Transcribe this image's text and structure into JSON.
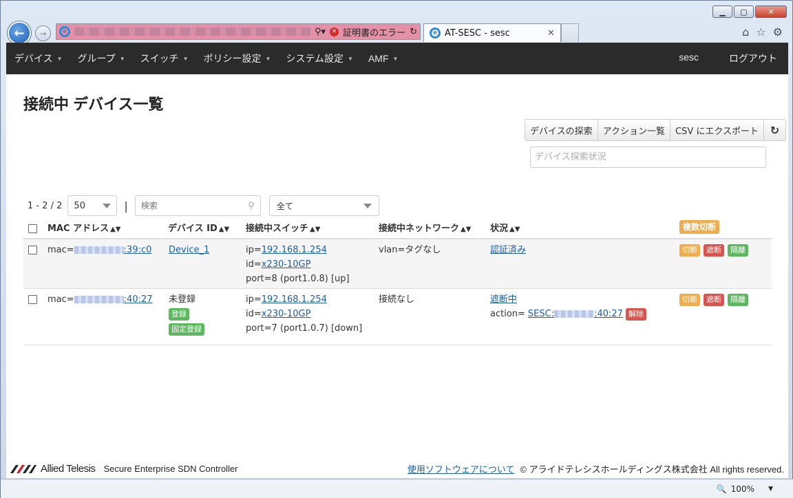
{
  "browser": {
    "cert_error": "証明書のエラー",
    "tab_title": "AT-SESC - sesc",
    "zoom": "100%"
  },
  "nav": {
    "items": [
      "デバイス",
      "グループ",
      "スイッチ",
      "ポリシー設定",
      "システム設定",
      "AMF"
    ],
    "user": "sesc",
    "logout": "ログアウト"
  },
  "page": {
    "title": "接続中 デバイス一覧",
    "actions": [
      "デバイスの探索",
      "アクション一覧",
      "CSV にエクスポート"
    ],
    "search_status_placeholder": "デバイス探索状況"
  },
  "toolbar": {
    "range": "1 - 2 / 2",
    "page_size": "50",
    "search_placeholder": "検索",
    "filter": "全て"
  },
  "table": {
    "headers": {
      "mac": "MAC アドレス",
      "device_id": "デバイス ID",
      "switch": "接続中スイッチ",
      "network": "接続中ネットワーク",
      "status": "状況",
      "bulk": "複数切断"
    },
    "rows": [
      {
        "mac_prefix": "mac=",
        "mac_suffix": ":39:c0",
        "device": "Device_1",
        "ip_label": "ip=",
        "ip": "192.168.1.254",
        "id_label": "id=",
        "switch_id": "x230-10GP",
        "port": "port=8 (port1.0.8) [up]",
        "network": "vlan=タグなし",
        "status": "認証済み",
        "buttons": [
          "切断",
          "遮断",
          "隔離"
        ]
      },
      {
        "mac_prefix": "mac=",
        "mac_suffix": ":40:27",
        "device": "未登録",
        "register": "登録",
        "fixed_register": "固定登録",
        "ip_label": "ip=",
        "ip": "192.168.1.254",
        "id_label": "id=",
        "switch_id": "x230-10GP",
        "port": "port=7 (port1.0.7) [down]",
        "network": "接続なし",
        "status": "遮断中",
        "action_label": "action=",
        "action_prefix": "SESC:",
        "action_suffix": ":40:27",
        "release": "解除",
        "buttons": [
          "切断",
          "遮断",
          "隔離"
        ]
      }
    ]
  },
  "footer": {
    "brand": "Allied Telesis",
    "product": "Secure Enterprise SDN Controller",
    "software_link": "使用ソフトウェアについて",
    "copyright": "© アライドテレシスホールディングス株式会社 All rights reserved."
  }
}
